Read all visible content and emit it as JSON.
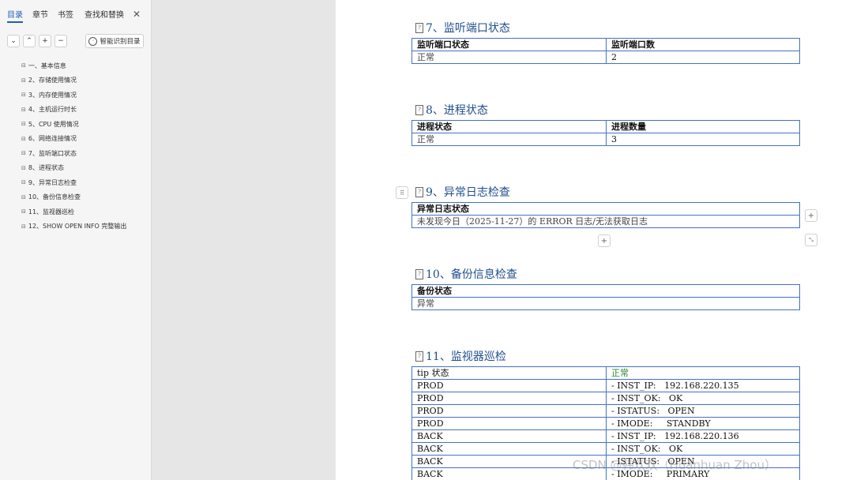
{
  "sidebar": {
    "tabs": [
      {
        "label": "目录"
      },
      {
        "label": "章节"
      },
      {
        "label": "书签"
      },
      {
        "label": "查找和替换"
      }
    ],
    "smart_button": "智能识别目录",
    "toc": [
      {
        "label": "一、基本信息"
      },
      {
        "label": "2、存储使用情况"
      },
      {
        "label": "3、内存使用情况"
      },
      {
        "label": "4、主机运行时长"
      },
      {
        "label": "5、CPU 使用情况"
      },
      {
        "label": "6、网络连接情况"
      },
      {
        "label": "7、监听端口状态"
      },
      {
        "label": "8、进程状态"
      },
      {
        "label": "9、异常日志检查"
      },
      {
        "label": "10、备份信息检查"
      },
      {
        "label": "11、监视器巡检"
      },
      {
        "label": "12、SHOW OPEN INFO 完整输出"
      }
    ]
  },
  "doc": {
    "s7": {
      "title": "7、监听端口状态",
      "h1": "监听端口状态",
      "h2": "监听端口数",
      "v1": "正常",
      "v2": "2"
    },
    "s8": {
      "title": "8、进程状态",
      "h1": "进程状态",
      "h2": "进程数量",
      "v1": "正常",
      "v2": "3"
    },
    "s9": {
      "title": "9、异常日志检查",
      "h1": "异常日志状态",
      "v1": "未发现今日（2025-11-27）的 ERROR 日志/无法获取日志"
    },
    "s10": {
      "title": "10、备份信息检查",
      "h1": "备份状态",
      "v1": "异常"
    },
    "s11": {
      "title": "11、监视器巡检",
      "rows": [
        {
          "c1": "tip 状态",
          "c2": "正常"
        },
        {
          "c1": "PROD",
          "c2": "- INST_IP:   192.168.220.135"
        },
        {
          "c1": "PROD",
          "c2": "- INST_OK:   OK"
        },
        {
          "c1": "PROD",
          "c2": "- ISTATUS:   OPEN"
        },
        {
          "c1": "PROD",
          "c2": "- IMODE:     STANDBY"
        },
        {
          "c1": "BACK",
          "c2": "- INST_IP:   192.168.220.136"
        },
        {
          "c1": "BACK",
          "c2": "- INST_OK:   OK"
        },
        {
          "c1": "BACK",
          "c2": "- ISTATUS:   OPEN"
        },
        {
          "c1": "BACK",
          "c2": "- IMODE:     PRIMARY"
        }
      ]
    }
  },
  "watermark": "CSDN @韩欢欢（Huanhuan Zhou）"
}
